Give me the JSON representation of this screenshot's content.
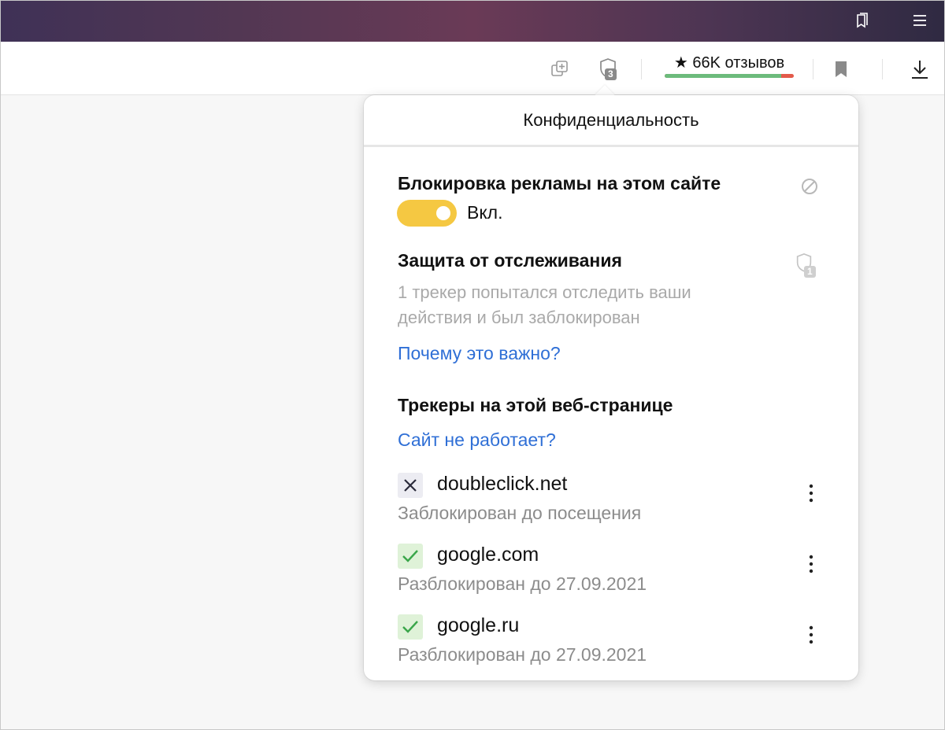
{
  "toolbar": {
    "tracker_badge": "3",
    "reviews_label": "66K отзывов",
    "reviews_positive_fraction": 0.9
  },
  "popup": {
    "title": "Конфиденциальность",
    "ad_block": {
      "title": "Блокировка рекламы на этом сайте",
      "toggle_state": "Вкл.",
      "enabled": true
    },
    "tracking": {
      "title": "Защита от отслеживания",
      "badge": "1",
      "description_line1": "1 трекер попытался отследить ваши",
      "description_line2": "действия и был заблокирован",
      "why_link": "Почему это важно?"
    },
    "trackers_section": {
      "title": "Трекеры на этой веб-странице",
      "broken_link": "Сайт не работает?",
      "items": [
        {
          "domain": "doubleclick.net",
          "status_text": "Заблокирован до посещения",
          "status": "blocked"
        },
        {
          "domain": "google.com",
          "status_text": "Разблокирован до 27.09.2021",
          "status": "allowed"
        },
        {
          "domain": "google.ru",
          "status_text": "Разблокирован до 27.09.2021",
          "status": "allowed"
        }
      ]
    }
  },
  "colors": {
    "toggle_on": "#f5c842",
    "link": "#2f6fd6",
    "allowed_check": "#3aa64a",
    "review_positive": "#6cbb7c",
    "review_negative": "#e35a4a"
  }
}
